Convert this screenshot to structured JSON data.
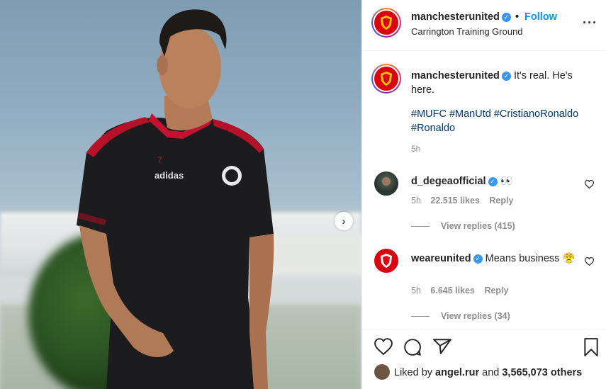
{
  "post": {
    "username": "manchesterunited",
    "follow_label": "Follow",
    "location": "Carrington Training Ground",
    "verified_glyph": "✓"
  },
  "caption": {
    "username": "manchesterunited",
    "text": "It's real. He's here.",
    "hashtags": "#MUFC #ManUtd #CristianoRonaldo #Ronaldo",
    "time": "5h"
  },
  "comments": [
    {
      "username": "d_degeaofficial",
      "text": "👀",
      "time": "5h",
      "likes": "22.515 likes",
      "reply_label": "Reply",
      "view_replies": "View replies (415)"
    },
    {
      "username": "weareunited",
      "text": "Means business 😤",
      "time": "5h",
      "likes": "6.645 likes",
      "reply_label": "Reply",
      "view_replies": "View replies (34)"
    }
  ],
  "likes_bar": {
    "prefix": "Liked by",
    "user": "angel.rur",
    "conjunction": "and",
    "count": "3,565,073 others"
  },
  "colors": {
    "brand_red": "#da020e",
    "link_blue": "#0095f6",
    "hashtag_blue": "#00376b",
    "muted": "#8e8e8e"
  },
  "icons": {
    "more": "more-options-icon",
    "like": "heart-icon",
    "comment": "comment-icon",
    "share": "share-icon",
    "save": "bookmark-icon",
    "next": "carousel-next-icon"
  }
}
